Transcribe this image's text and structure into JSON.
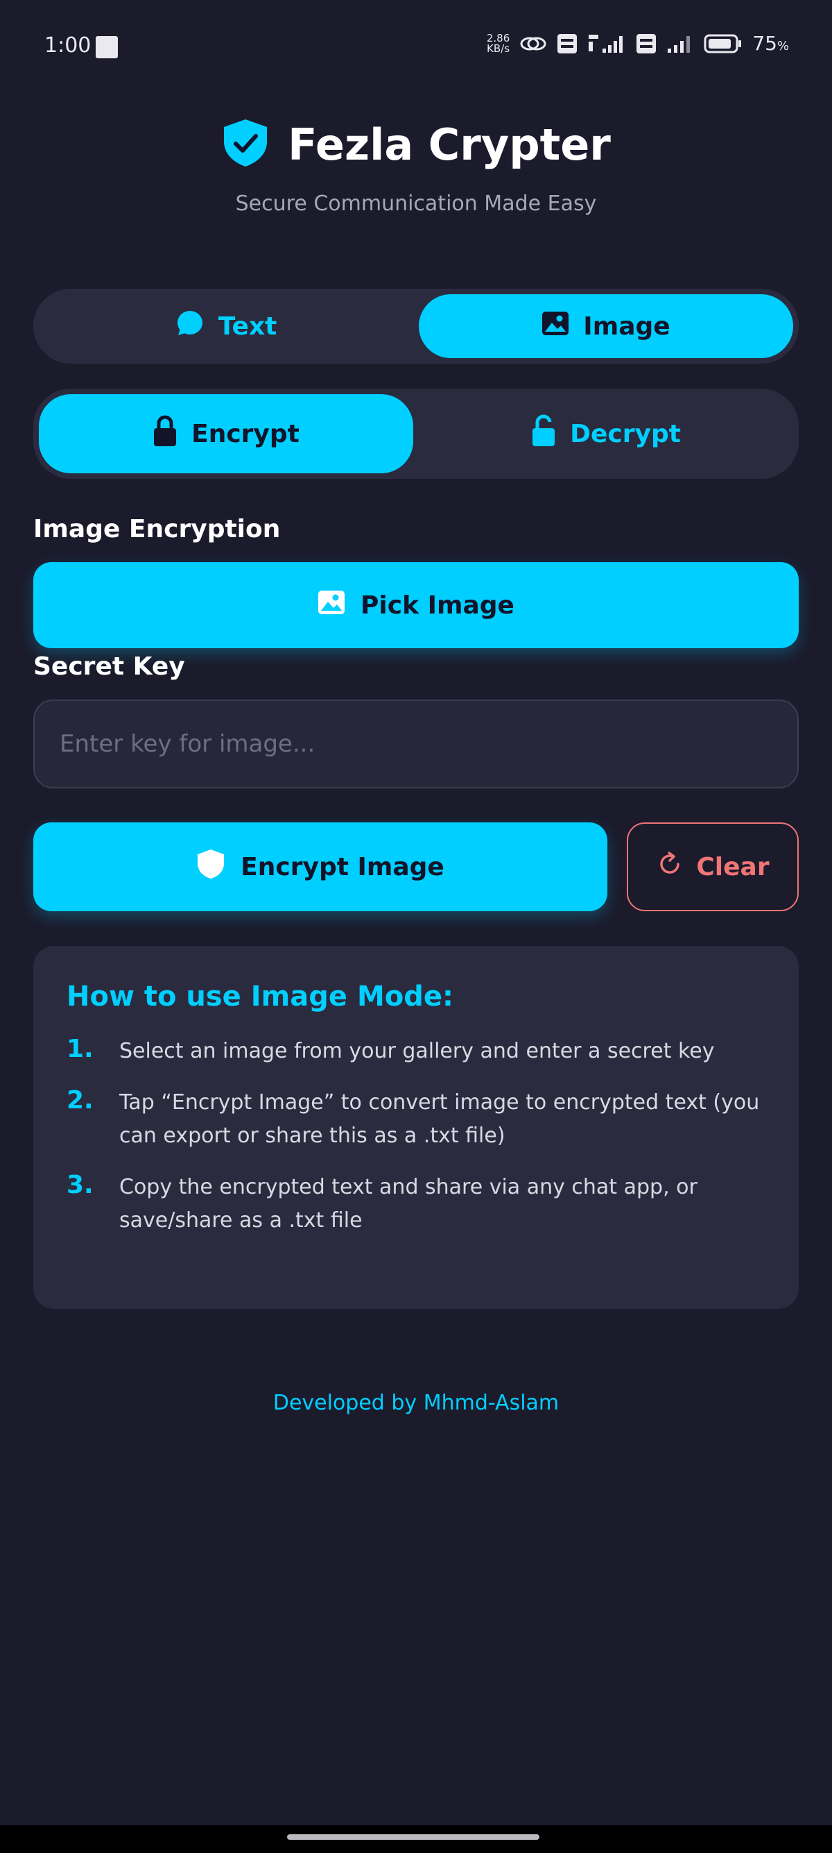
{
  "status_bar": {
    "time": "1:00",
    "net_speed_value": "2.86",
    "net_speed_unit": "KB/s",
    "battery_percent": "75",
    "battery_unit": "%"
  },
  "header": {
    "title": "Fezla Crypter",
    "subtitle": "Secure Communication Made Easy"
  },
  "mode_tabs": [
    {
      "label": "Text",
      "icon": "chat-bubble-icon",
      "active": false
    },
    {
      "label": "Image",
      "icon": "image-icon",
      "active": true
    }
  ],
  "action_tabs": [
    {
      "label": "Encrypt",
      "icon": "lock-icon",
      "active": true
    },
    {
      "label": "Decrypt",
      "icon": "unlock-icon",
      "active": false
    }
  ],
  "image_encryption": {
    "section_label": "Image Encryption",
    "pick_image_label": "Pick Image",
    "secret_key_label": "Secret Key",
    "secret_key_value": "",
    "secret_key_placeholder": "Enter key for image...",
    "encrypt_button_label": "Encrypt Image",
    "clear_button_label": "Clear"
  },
  "how_to": {
    "title": "How to use Image Mode:",
    "steps": [
      {
        "num": "1.",
        "text": "Select an image from your gallery and enter a secret key"
      },
      {
        "num": "2.",
        "text": "Tap “Encrypt Image” to convert image to encrypted text (you can export or share this as a .txt file)"
      },
      {
        "num": "3.",
        "text": "Copy the encrypted text and share via any chat app, or save/share as a .txt file"
      }
    ]
  },
  "footer": {
    "credit": "Developed by Mhmd-Aslam"
  },
  "colors": {
    "background": "#1b1b2c",
    "surface": "#2a2b3e",
    "accent": "#00cfff",
    "danger": "#f07575",
    "muted_text": "#a6a8b6"
  }
}
